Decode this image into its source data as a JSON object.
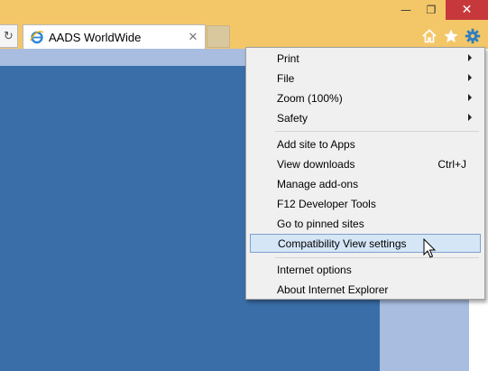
{
  "window": {
    "minimize_glyph": "—",
    "maximize_glyph": "❐",
    "close_glyph": "✕"
  },
  "toolbar": {
    "refresh_glyph": "↻",
    "icons": [
      "refresh-icon",
      "home-icon",
      "star-icon",
      "gear-icon"
    ],
    "accent_color": "#2f7fc1"
  },
  "tab": {
    "title": "AADS WorldWide",
    "close_glyph": "✕",
    "favicon": "ie-icon"
  },
  "menu": {
    "items": [
      {
        "label": "Print",
        "submenu": true
      },
      {
        "label": "File",
        "submenu": true
      },
      {
        "label": "Zoom (100%)",
        "submenu": true
      },
      {
        "label": "Safety",
        "submenu": true
      },
      {
        "label": "Add site to Apps"
      },
      {
        "label": "View downloads",
        "shortcut": "Ctrl+J"
      },
      {
        "label": "Manage add-ons"
      },
      {
        "label": "F12 Developer Tools"
      },
      {
        "label": "Go to pinned sites"
      },
      {
        "label": "Compatibility View settings",
        "highlighted": true
      },
      {
        "label": "Internet options"
      },
      {
        "label": "About Internet Explorer"
      }
    ]
  },
  "colors": {
    "titlebar": "#f3c768",
    "page_blue": "#3a6ea8",
    "page_light": "#a9bde0",
    "highlight": "#d5e6f7",
    "close_red": "#c7383c"
  }
}
